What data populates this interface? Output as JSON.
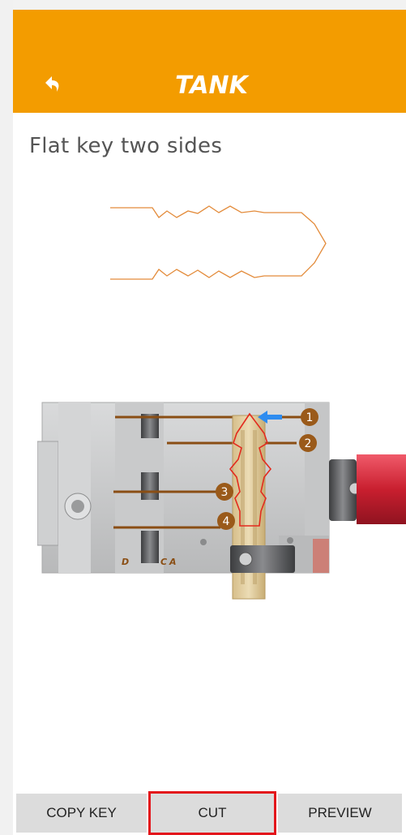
{
  "header": {
    "brand": "TANK",
    "background_color": "#f39c00",
    "back_icon": "back-arrow-icon"
  },
  "page": {
    "title": "Flat key two sides"
  },
  "diagram": {
    "markers": [
      "1",
      "2",
      "3",
      "4"
    ],
    "jaw_labels": {
      "d": "D",
      "c": "C",
      "a": "A"
    },
    "outline_color": "#e38b3a",
    "cut_line_color": "#e32a1e",
    "marker_color": "#9a5a1a",
    "arrow_color": "#2e8cf0"
  },
  "bottom_bar": {
    "copy_key_label": "COPY KEY",
    "cut_label": "CUT",
    "preview_label": "PREVIEW",
    "highlight_color": "#e3151b"
  }
}
